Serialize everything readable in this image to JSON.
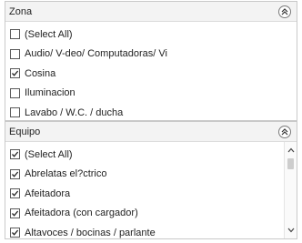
{
  "zona": {
    "title": "Zona",
    "items": [
      {
        "label": "(Select All)",
        "checked": false
      },
      {
        "label": "Audio/ V-deo/ Computadoras/ Vi",
        "checked": false
      },
      {
        "label": "Cosina",
        "checked": true
      },
      {
        "label": "Iluminacion",
        "checked": false
      },
      {
        "label": "Lavabo / W.C. / ducha",
        "checked": false
      }
    ]
  },
  "equipo": {
    "title": "Equipo",
    "items": [
      {
        "label": "(Select All)",
        "checked": true
      },
      {
        "label": "Abrelatas el?ctrico",
        "checked": true
      },
      {
        "label": "Afeitadora",
        "checked": true
      },
      {
        "label": "Afeitadora (con cargador)",
        "checked": true
      },
      {
        "label": "Altavoces / bocinas / parlante",
        "checked": true
      }
    ]
  },
  "icons": {
    "collapse": "double-chevron-up-icon",
    "scroll_up": "scroll-up-arrow-icon",
    "scroll_down": "scroll-down-arrow-icon",
    "check": "check-icon"
  }
}
